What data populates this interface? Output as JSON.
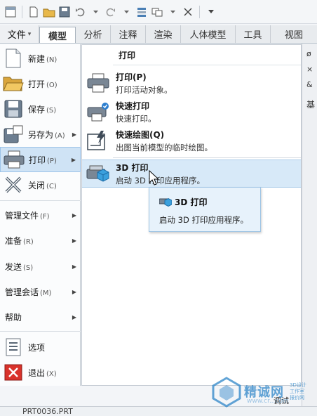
{
  "tabs": {
    "file": "文件",
    "items": [
      "模型",
      "分析",
      "注释",
      "渲染",
      "人体模型",
      "工具",
      "视图"
    ],
    "active_index": 0
  },
  "file_menu": {
    "items": [
      {
        "label": "新建",
        "accel": "(N)",
        "icon": "new-document-icon"
      },
      {
        "label": "打开",
        "accel": "(O)",
        "icon": "open-folder-icon"
      },
      {
        "label": "保存",
        "accel": "(S)",
        "icon": "save-icon"
      },
      {
        "label": "另存为",
        "accel": "(A)",
        "icon": "save-as-icon"
      },
      {
        "label": "打印",
        "accel": "(P)",
        "icon": "print-icon"
      },
      {
        "label": "关闭",
        "accel": "(C)",
        "icon": "close-icon"
      },
      {
        "label": "管理文件",
        "accel": "(F)"
      },
      {
        "label": "准备",
        "accel": "(R)"
      },
      {
        "label": "发送",
        "accel": "(S)"
      },
      {
        "label": "管理会话",
        "accel": "(M)"
      },
      {
        "label": "帮助",
        "accel": ""
      },
      {
        "label": "选项",
        "accel": "",
        "icon": "options-icon"
      },
      {
        "label": "退出",
        "accel": "(X)",
        "icon": "exit-icon"
      }
    ],
    "selected": "打印"
  },
  "print_panel": {
    "heading": "打印",
    "items": [
      {
        "title": "打印(P)",
        "desc": "打印活动对象。"
      },
      {
        "title": "快速打印",
        "desc": "快速打印。"
      },
      {
        "title": "快速绘图(Q)",
        "desc": "出图当前模型的临时绘图。"
      },
      {
        "title": "3D 打印",
        "desc": "启动 3D 打印应用程序。"
      }
    ]
  },
  "tooltip": {
    "title": "3D 打印",
    "desc": "启动 3D 打印应用程序。"
  },
  "background": {
    "right_strip_char": "基",
    "bottom_file": "PRT0036.PRT",
    "status": "调试"
  },
  "watermark": {
    "main": "精诚网",
    "side": "3D设计 工作室 报价网",
    "url": "www.cr...com"
  },
  "colors": {
    "accent_blue": "#2e86c9",
    "selected_bg": "#cfe3f5",
    "exit_red": "#d9322b"
  }
}
